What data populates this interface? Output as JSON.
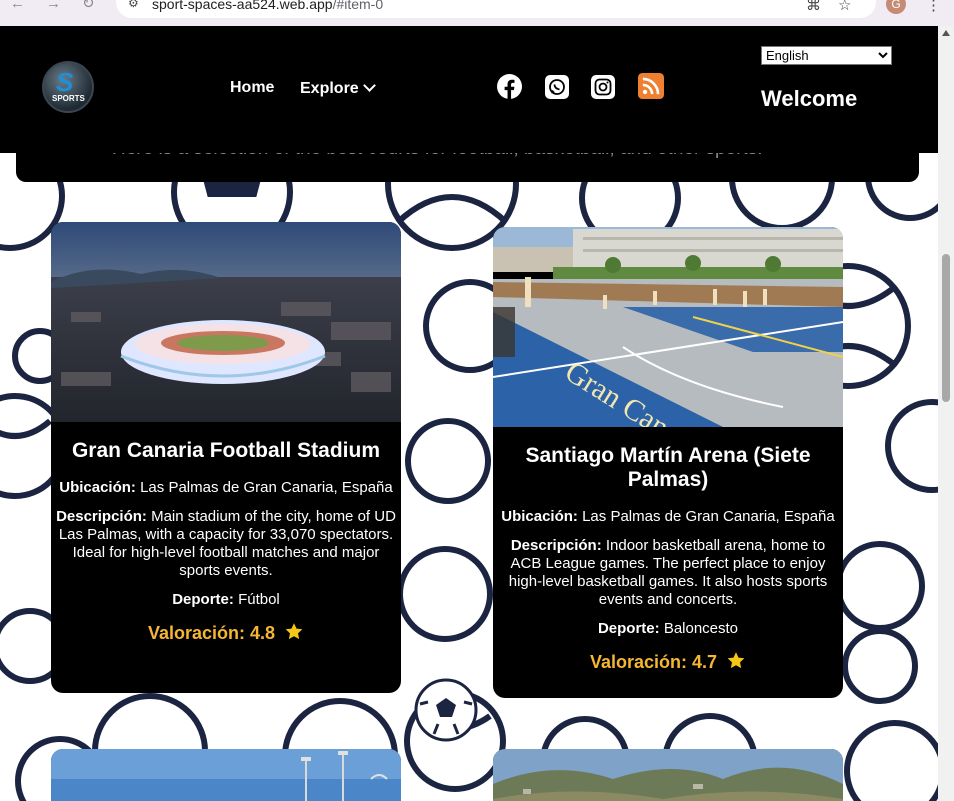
{
  "browser": {
    "url_prefix": "sport-spaces-aa524.web.app",
    "url_suffix": "/#item-0",
    "profile_initial": "G"
  },
  "header": {
    "logo_text": "SPORTS",
    "nav": {
      "home": "Home",
      "explore": "Explore"
    },
    "social_icons": [
      "facebook-icon",
      "whatsapp-icon",
      "instagram-icon",
      "rss-icon"
    ],
    "language": {
      "selected": "English",
      "options": [
        "English"
      ]
    },
    "welcome": "Welcome"
  },
  "intro": {
    "text": "Here is a selection of the best courts for football, basketball, and other sports."
  },
  "labels": {
    "location": "Ubicación:",
    "description": "Descripción:",
    "sport": "Deporte:",
    "rating": "Valoración:"
  },
  "cards": [
    {
      "title": "Gran Canaria Football Stadium",
      "location": "Las Palmas de Gran Canaria, España",
      "description": "Main stadium of the city, home of UD Las Palmas, with a capacity for 33,070 spectators. Ideal for high-level football matches and major sports events.",
      "sport": "Fútbol",
      "rating": "4.8"
    },
    {
      "title": "Santiago Martín Arena (Siete Palmas)",
      "location": "Las Palmas de Gran Canaria, España",
      "description": "Indoor basketball arena, home to ACB League games. The perfect place to enjoy high-level basketball games. It also hosts sports events and concerts.",
      "sport": "Baloncesto",
      "rating": "4.7"
    }
  ],
  "colors": {
    "header_bg": "#000000",
    "card_bg": "#000000",
    "rating": "#f5b731",
    "rss": "#ee802f",
    "pattern_stroke": "#1b2440"
  }
}
